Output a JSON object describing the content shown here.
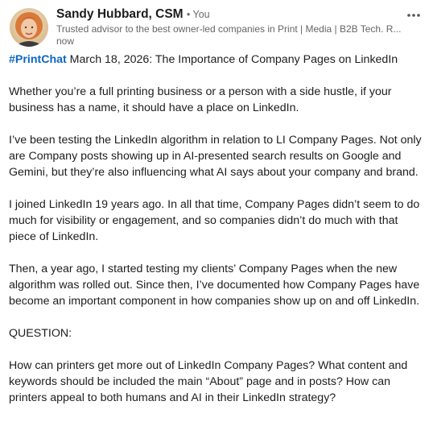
{
  "author": {
    "name": "Sandy Hubbard, CSM",
    "degree": "• You",
    "headline": "Trusted advisor to the best owner-led companies in Print | Media | B2B Tech. R...",
    "time": "now"
  },
  "icons": {
    "avatar": "profile-photo",
    "more": "ellipsis-horizontal-icon"
  },
  "colors": {
    "link": "#0a66c2",
    "text": "#1d1d1d",
    "muted": "#666666"
  },
  "post": {
    "hashtag": "#PrintChat",
    "title_rest": " March 18, 2026: The Importance of Company Pages on LinkedIn",
    "paragraphs": [
      "Whether you’re a full printing business or a person with a side hustle, if your business has a name, it should have a place on LinkedIn.",
      "I’ve been testing the LinkedIn algorithm in relation to LI Company Pages. Not only are Company posts showing up in AI-presented search results on Google and Gemini, but they’re also influencing what AI says about your company and brand.",
      "I joined LinkedIn 19 years ago. In all that time, Company Pages didn’t seem to do much for visibility or engagement, and so companies didn’t do much with that piece of LinkedIn.",
      "Then, a year ago, I started testing my clients’ Company Pages when the new algorithm was rolled out. Since then, I’ve documented how Company Pages have become an important component in how companies show up on and off LinkedIn.",
      "QUESTION:",
      "How can printers get more out of LinkedIn Company Pages? What content and keywords should be included the main “About” page and in posts? How can printers appeal to both humans and AI in their LinkedIn strategy?"
    ]
  }
}
